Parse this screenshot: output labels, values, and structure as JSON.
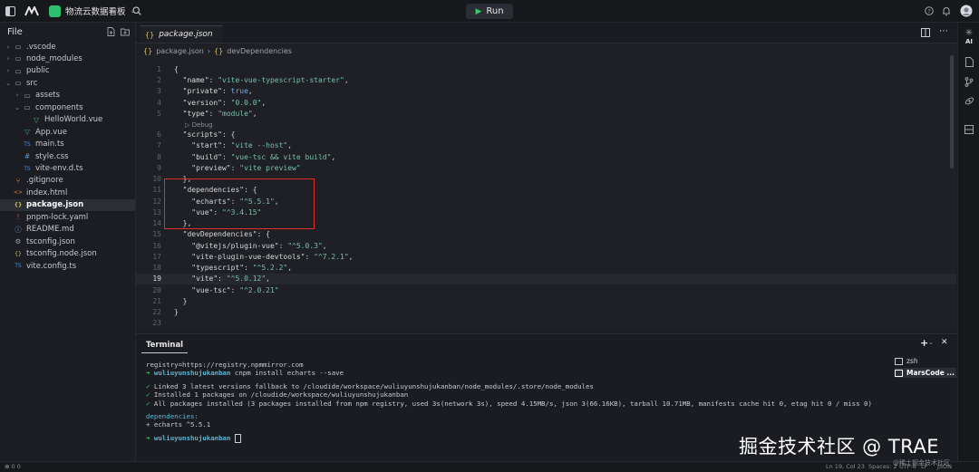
{
  "titlebar": {
    "project_name": "物流云数据看板",
    "run_label": "Run"
  },
  "sidebar": {
    "title": "File",
    "items": [
      {
        "label": ".vscode",
        "kind": "folder",
        "expanded": false,
        "depth": 0
      },
      {
        "label": "node_modules",
        "kind": "folder",
        "expanded": false,
        "depth": 0
      },
      {
        "label": "public",
        "kind": "folder",
        "expanded": false,
        "depth": 0
      },
      {
        "label": "src",
        "kind": "folder",
        "expanded": true,
        "depth": 0
      },
      {
        "label": "assets",
        "kind": "folder",
        "expanded": false,
        "depth": 1
      },
      {
        "label": "components",
        "kind": "folder",
        "expanded": true,
        "depth": 1
      },
      {
        "label": "HelloWorld.vue",
        "kind": "vue",
        "depth": 2
      },
      {
        "label": "App.vue",
        "kind": "vue",
        "depth": 1
      },
      {
        "label": "main.ts",
        "kind": "ts",
        "depth": 1
      },
      {
        "label": "style.css",
        "kind": "css",
        "depth": 1
      },
      {
        "label": "vite-env.d.ts",
        "kind": "ts",
        "depth": 1
      },
      {
        "label": ".gitignore",
        "kind": "git",
        "depth": 0
      },
      {
        "label": "index.html",
        "kind": "html",
        "depth": 0
      },
      {
        "label": "package.json",
        "kind": "json",
        "depth": 0,
        "active": true
      },
      {
        "label": "pnpm-lock.yaml",
        "kind": "yaml",
        "depth": 0
      },
      {
        "label": "README.md",
        "kind": "md",
        "depth": 0
      },
      {
        "label": "tsconfig.json",
        "kind": "cfg",
        "depth": 0
      },
      {
        "label": "tsconfig.node.json",
        "kind": "json",
        "depth": 0
      },
      {
        "label": "vite.config.ts",
        "kind": "ts",
        "depth": 0
      }
    ]
  },
  "editor": {
    "tab_label": "package.json",
    "breadcrumb": [
      "package.json",
      "devDependencies"
    ],
    "debug_hint": "Debug",
    "current_line": 19,
    "lines": [
      {
        "n": "1",
        "t": "{"
      },
      {
        "n": "2",
        "t": "  \"name\": \"vite-vue-typescript-starter\","
      },
      {
        "n": "3",
        "t": "  \"private\": true,"
      },
      {
        "n": "4",
        "t": "  \"version\": \"0.0.0\","
      },
      {
        "n": "5",
        "t": "  \"type\": \"module\","
      },
      {
        "n": "6",
        "t": "  \"scripts\": {"
      },
      {
        "n": "7",
        "t": "    \"start\": \"vite --host\","
      },
      {
        "n": "8",
        "t": "    \"build\": \"vue-tsc && vite build\","
      },
      {
        "n": "9",
        "t": "    \"preview\": \"vite preview\""
      },
      {
        "n": "10",
        "t": "  },"
      },
      {
        "n": "11",
        "t": "  \"dependencies\": {"
      },
      {
        "n": "12",
        "t": "    \"echarts\": \"^5.5.1\","
      },
      {
        "n": "13",
        "t": "    \"vue\": \"^3.4.15\""
      },
      {
        "n": "14",
        "t": "  },"
      },
      {
        "n": "15",
        "t": "  \"devDependencies\": {"
      },
      {
        "n": "16",
        "t": "    \"@vitejs/plugin-vue\": \"^5.0.3\","
      },
      {
        "n": "17",
        "t": "    \"vite-plugin-vue-devtools\": \"^7.2.1\","
      },
      {
        "n": "18",
        "t": "    \"typescript\": \"^5.2.2\","
      },
      {
        "n": "19",
        "t": "    \"vite\": \"^5.0.12\","
      },
      {
        "n": "20",
        "t": "    \"vue-tsc\": \"^2.0.21\""
      },
      {
        "n": "21",
        "t": "  }"
      },
      {
        "n": "22",
        "t": "}"
      },
      {
        "n": "23",
        "t": ""
      }
    ]
  },
  "terminal": {
    "tab_label": "Terminal",
    "sessions": [
      "zsh",
      "MarsCode ..."
    ],
    "lines": [
      {
        "cls": "",
        "t": "registry=https://registry.npmmirror.com"
      },
      {
        "cls": "prompt",
        "user": "wuliuyunshujukanban",
        "cmd": "cnpm install echarts --save"
      },
      {
        "cls": "blank",
        "t": ""
      },
      {
        "cls": "ok",
        "t": "Linked 3 latest versions fallback to /cloudide/workspace/wuliuyunshujukanban/node_modules/.store/node_modules"
      },
      {
        "cls": "ok",
        "t": "Installed 1 packages on /cloudide/workspace/wuliuyunshujukanban"
      },
      {
        "cls": "ok",
        "t": "All packages installed (3 packages installed from npm registry, used 3s(network 3s), speed 4.15MB/s, json 3(66.16KB), tarball 10.71MB, manifests cache hit 0, etag hit 0 / miss 0)"
      },
      {
        "cls": "blank",
        "t": ""
      },
      {
        "cls": "cyan",
        "t": "dependencies:"
      },
      {
        "cls": "dep",
        "t": "+ echarts ^5.5.1"
      },
      {
        "cls": "blank",
        "t": ""
      },
      {
        "cls": "prompt2",
        "user": "wuliuyunshujukanban",
        "cmd": ""
      }
    ]
  },
  "statusbar": {
    "left": "0  0",
    "position": "Ln 19, Col 23",
    "spaces": "Spaces: 2",
    "encoding": "UTF-8",
    "eol": "LF",
    "language": "JSON"
  },
  "watermark": {
    "text": "掘金技术社区 @ TRAE",
    "sub": "@稀土掘金技术社区"
  }
}
